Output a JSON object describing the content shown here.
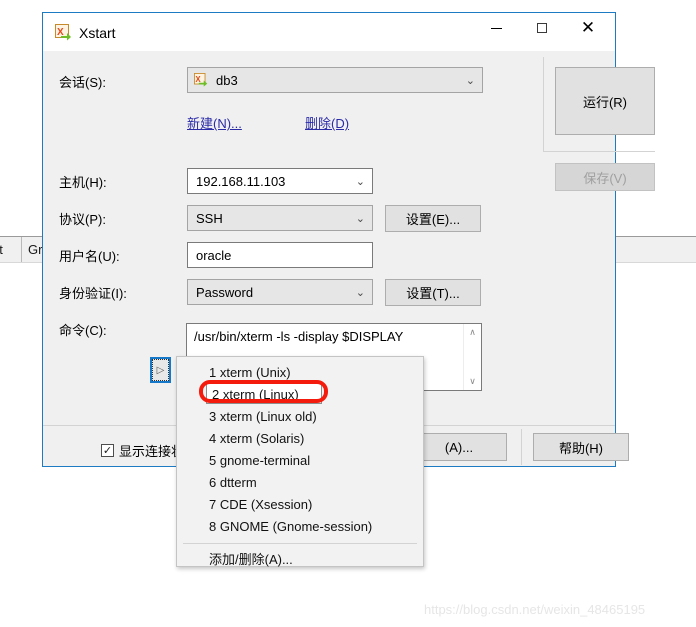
{
  "window": {
    "title": "Xstart",
    "app_icon": "xstart-icon",
    "minimize": "–",
    "maximize": "□",
    "close": "✕"
  },
  "session": {
    "label": "会话(S):",
    "value": "db3",
    "icon": "xstart-icon",
    "new_link": "新建(N)...",
    "delete_link": "删除(D)",
    "more_arrow": "▽",
    "dropdown_arrow": "⌄"
  },
  "fields": {
    "host": {
      "label": "主机(H):",
      "value": "192.168.11.103",
      "arrow": "⌄"
    },
    "protocol": {
      "label": "协议(P):",
      "value": "SSH",
      "arrow": "⌄",
      "settings_button": "设置(E)..."
    },
    "username": {
      "label": "用户名(U):",
      "value": "oracle"
    },
    "authentication": {
      "label": "身份验证(I):",
      "value": "Password",
      "arrow": "⌄",
      "settings_button": "设置(T)..."
    },
    "command": {
      "label": "命令(C):",
      "value": "/usr/bin/xterm -ls -display $DISPLAY",
      "scroll_up": "∧",
      "scroll_down": "∨",
      "expand_button_glyph": "▷"
    }
  },
  "command_menu": {
    "items": [
      "1 xterm (Unix)",
      "2 xterm (Linux)",
      "3 xterm (Linux old)",
      "4 xterm (Solaris)",
      "5 gnome-terminal",
      "6 dtterm",
      "7 CDE (Xsession)",
      "8 GNOME (Gnome-session)"
    ],
    "selected_index": 1,
    "add_remove": "添加/删除(A)..."
  },
  "buttons": {
    "run": "运行(R)",
    "save": "保存(V)",
    "advanced": "(A)...",
    "help": "帮助(H)"
  },
  "options": {
    "show_status_label": "显示连接状态对话",
    "show_status_checked": "✓"
  },
  "background_window": {
    "tab_1": "nt",
    "tab_2": "Gra"
  },
  "watermark": "https://blog.csdn.net/weixin_48465195",
  "colors": {
    "dialog_border": "#1d7bc4",
    "annotation_red": "#f41b0c",
    "link_blue": "#2b2ba8",
    "dialog_background": "#f0f0f0"
  }
}
